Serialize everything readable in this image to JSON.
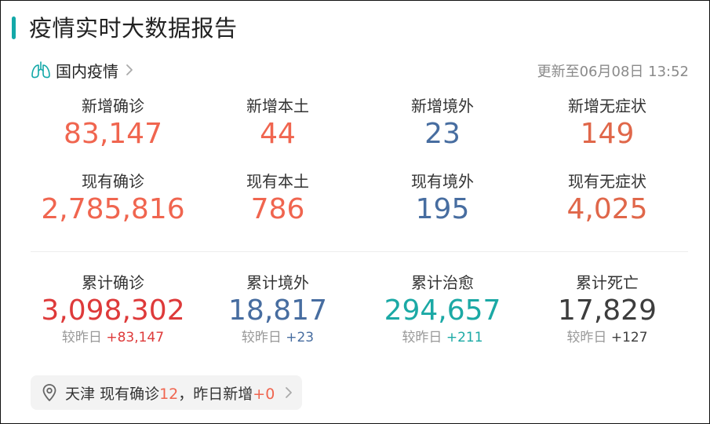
{
  "title": "疫情实时大数据报告",
  "section": {
    "label": "国内疫情",
    "icon": "lungs-icon"
  },
  "update_text": "更新至06月08日 13:52",
  "rows": [
    [
      {
        "label": "新增确诊",
        "value": "83,147",
        "color": "#f0654f"
      },
      {
        "label": "新增本土",
        "value": "44",
        "color": "#f0654f"
      },
      {
        "label": "新增境外",
        "value": "23",
        "color": "#476da0"
      },
      {
        "label": "新增无症状",
        "value": "149",
        "color": "#e0674a"
      }
    ],
    [
      {
        "label": "现有确诊",
        "value": "2,785,816",
        "color": "#f0654f"
      },
      {
        "label": "现有本土",
        "value": "786",
        "color": "#f0654f"
      },
      {
        "label": "现有境外",
        "value": "195",
        "color": "#476da0"
      },
      {
        "label": "现有无症状",
        "value": "4,025",
        "color": "#e0674a"
      }
    ]
  ],
  "cumulative": [
    {
      "label": "累计确诊",
      "value": "3,098,302",
      "color": "#de3a3a",
      "cmp_label": "较昨日",
      "cmp_value": "+83,147",
      "cmp_color": "#de3a3a"
    },
    {
      "label": "累计境外",
      "value": "18,817",
      "color": "#476da0",
      "cmp_label": "较昨日",
      "cmp_value": "+23",
      "cmp_color": "#476da0"
    },
    {
      "label": "累计治愈",
      "value": "294,657",
      "color": "#1ba9a5",
      "cmp_label": "较昨日",
      "cmp_value": "+211",
      "cmp_color": "#1ba9a5"
    },
    {
      "label": "累计死亡",
      "value": "17,829",
      "color": "#3d3d3d",
      "cmp_label": "较昨日",
      "cmp_value": "+127",
      "cmp_color": "#3d3d3d"
    }
  ],
  "local": {
    "city": "天津",
    "current_label": "现有确诊",
    "current_value": "12",
    "sep": "，",
    "new_label": "昨日新增",
    "new_value": "+0",
    "icon": "location-pin-icon"
  },
  "colors": {
    "accent": "#13a8a8",
    "confirmed": "#f0654f",
    "imported": "#476da0",
    "cured": "#1ba9a5"
  }
}
